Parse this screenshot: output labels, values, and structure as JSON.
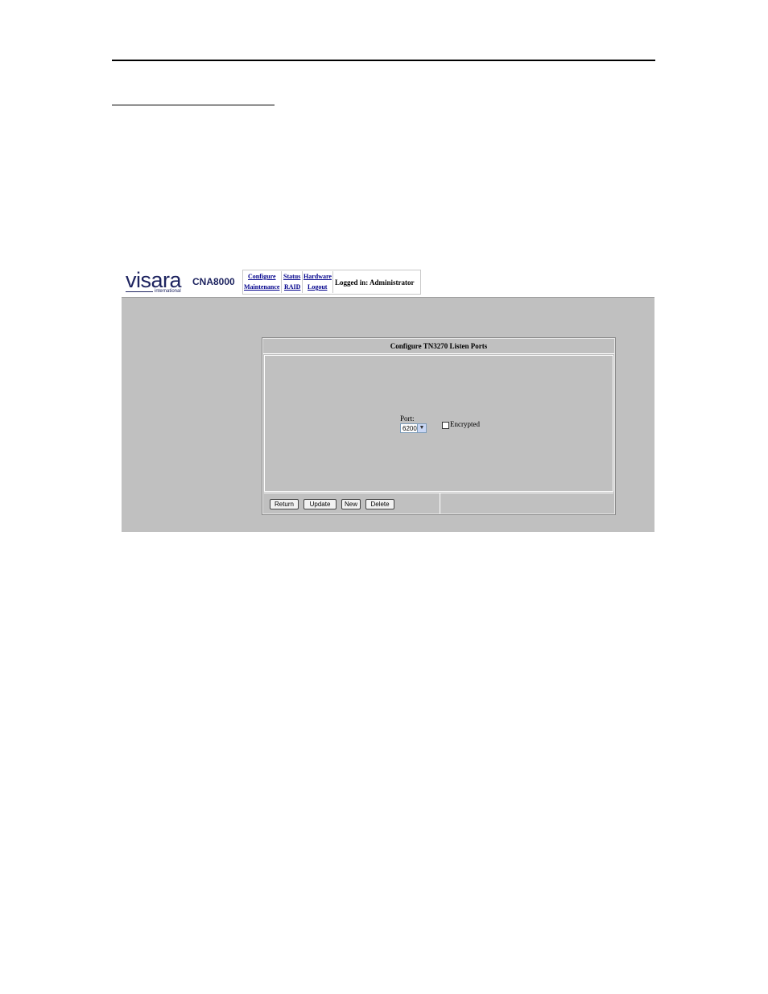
{
  "header": {
    "logo_word": "visara",
    "logo_sub": "international",
    "product": "CNA8000"
  },
  "nav": {
    "configure": "Configure",
    "status": "Status",
    "hardware": "Hardware",
    "maintenance": "Maintenance",
    "raid": "RAID",
    "logout": "Logout",
    "logged_in": "Logged in: Administrator"
  },
  "panel": {
    "title": "Configure TN3270 Listen Ports",
    "port_label": "Port:",
    "port_value": "6200",
    "encrypted_label": "Encrypted",
    "encrypted_checked": false
  },
  "buttons": {
    "return": "Return",
    "update": "Update",
    "new": "New",
    "delete": "Delete"
  },
  "icons": {
    "dropdown": "chevron-down-icon"
  }
}
